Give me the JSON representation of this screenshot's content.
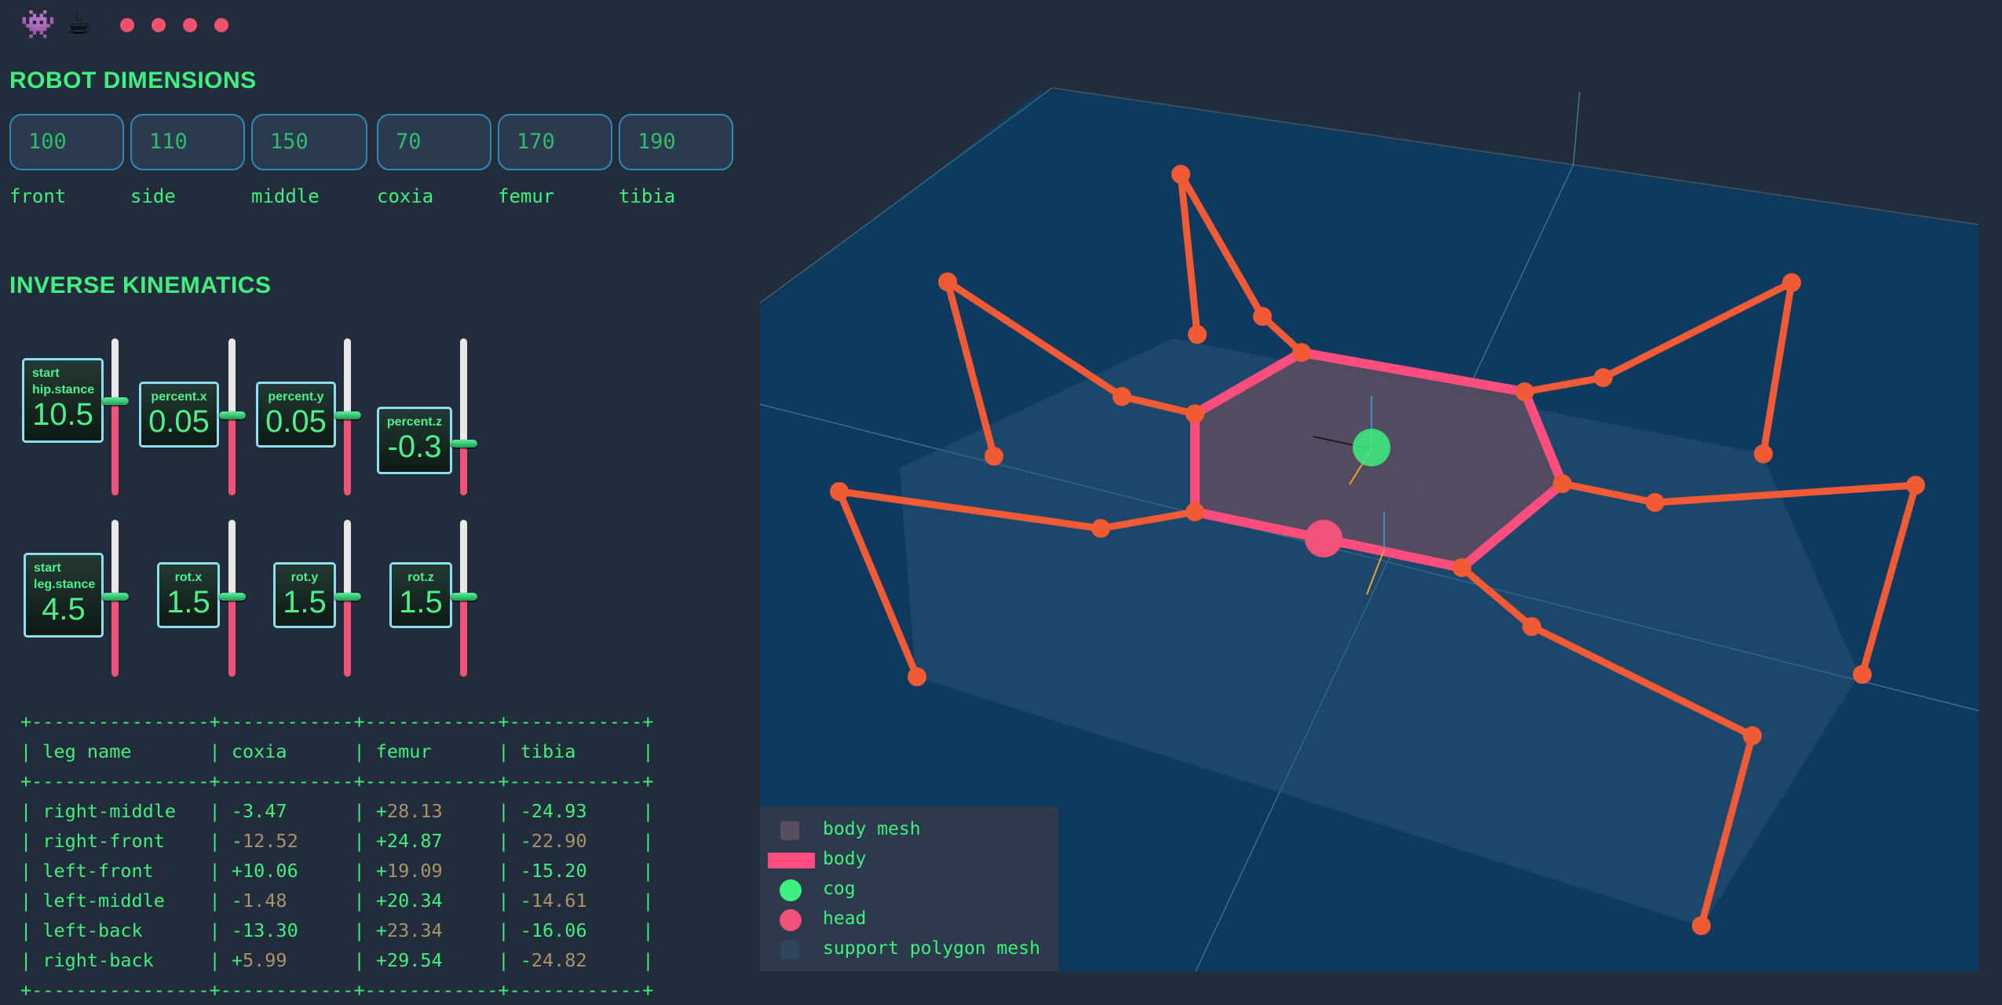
{
  "top_icons": [
    {
      "name": "alien-monster-icon",
      "glyph": "👾"
    },
    {
      "name": "coffee-icon",
      "glyph": "☕"
    }
  ],
  "sections": {
    "dimensions_title": "ROBOT DIMENSIONS",
    "ik_title": "INVERSE KINEMATICS"
  },
  "dimensions": [
    {
      "label": "front",
      "value": "100"
    },
    {
      "label": "side",
      "value": "110"
    },
    {
      "label": "middle",
      "value": "150"
    },
    {
      "label": "coxia",
      "value": "70"
    },
    {
      "label": "femur",
      "value": "170"
    },
    {
      "label": "tibia",
      "value": "190"
    }
  ],
  "ik_controls": [
    {
      "label_lines": [
        "start",
        "hip.stance"
      ],
      "value": "10.5",
      "level": 0.4
    },
    {
      "label_lines": [
        "percent.x"
      ],
      "value": "0.05",
      "level": 0.49
    },
    {
      "label_lines": [
        "percent.y"
      ],
      "value": "0.05",
      "level": 0.49
    },
    {
      "label_lines": [
        "percent.z"
      ],
      "value": "-0.3",
      "level": 0.67
    },
    {
      "label_lines": [
        "start",
        "leg.stance"
      ],
      "value": "4.5",
      "level": 0.49
    },
    {
      "label_lines": [
        "rot.x"
      ],
      "value": "1.5",
      "level": 0.49
    },
    {
      "label_lines": [
        "rot.y"
      ],
      "value": "1.5",
      "level": 0.49
    },
    {
      "label_lines": [
        "rot.z"
      ],
      "value": "1.5",
      "level": 0.49
    }
  ],
  "leg_table": {
    "border": "+----------------+------------+------------+------------+",
    "headers": [
      "leg name",
      "coxia",
      "femur",
      "tibia"
    ],
    "rows": [
      {
        "name": "right-middle",
        "coxia": "-3.47",
        "femur": "+28.13",
        "tibia": "-24.93"
      },
      {
        "name": "right-front",
        "coxia": "-12.52",
        "femur": "+24.87",
        "tibia": "-22.90"
      },
      {
        "name": "left-front",
        "coxia": "+10.06",
        "femur": "+19.09",
        "tibia": "-15.20"
      },
      {
        "name": "left-middle",
        "coxia": "-1.48",
        "femur": "+20.34",
        "tibia": "-14.61"
      },
      {
        "name": "left-back",
        "coxia": "-13.30",
        "femur": "+23.34",
        "tibia": "-16.06"
      },
      {
        "name": "right-back",
        "coxia": "+5.99",
        "femur": "+29.54",
        "tibia": "-24.82"
      }
    ]
  },
  "legend": [
    {
      "label": "body mesh",
      "color": "#5a4d5f",
      "shape": "square"
    },
    {
      "label": "body",
      "color": "#ff4d7d",
      "shape": "bar"
    },
    {
      "label": "cog",
      "color": "#3df07f",
      "shape": "circle"
    },
    {
      "label": "head",
      "color": "#f0527a",
      "shape": "circle"
    },
    {
      "label": "support polygon mesh",
      "color": "#30445c",
      "shape": "square"
    }
  ],
  "colors": {
    "accent": "#3df07f",
    "leg": "#f05a34",
    "body": "#ff4d7d",
    "ground": "#0f3a5f"
  }
}
